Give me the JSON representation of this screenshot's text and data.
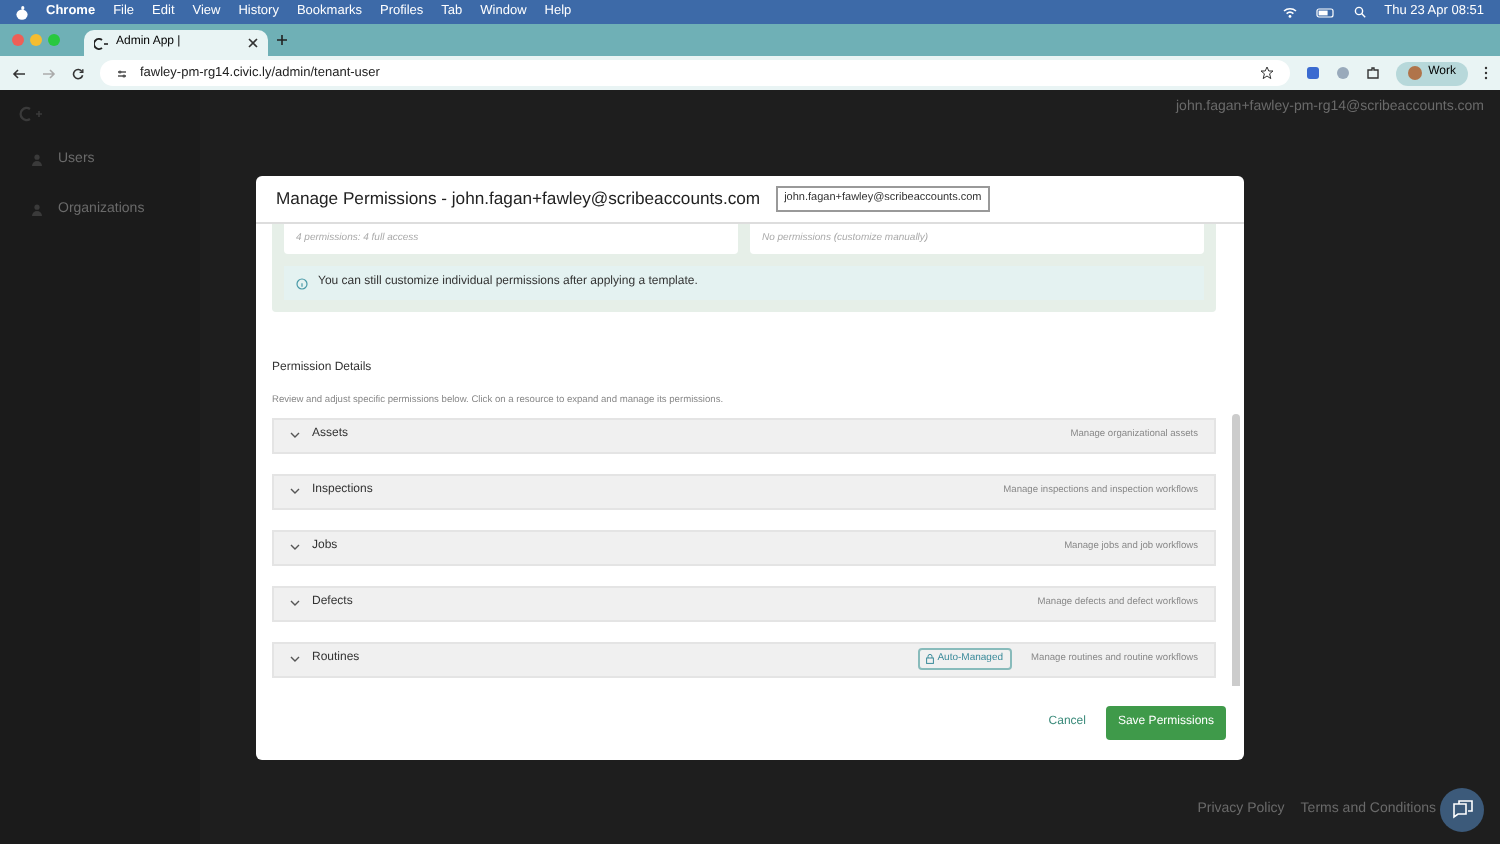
{
  "menubar": {
    "app": "Chrome",
    "menus": [
      "File",
      "Edit",
      "View",
      "History",
      "Bookmarks",
      "Profiles",
      "Tab",
      "Window",
      "Help"
    ],
    "clock": "Thu 23 Apr  08:51"
  },
  "browser": {
    "tabs": [
      {
        "title": "Admin App |",
        "selected": true
      }
    ],
    "url": "fawley-pm-rg14.civic.ly/admin/tenant-user",
    "profile": "Work"
  },
  "app": {
    "sidebar": {
      "items": [
        {
          "label": "Users"
        },
        {
          "label": "Organizations"
        }
      ]
    },
    "header_user": "john.fagan+fawley-pm-rg14@scribeaccounts.com",
    "footer_links": [
      "Privacy Policy",
      "Terms and Conditions"
    ]
  },
  "modal": {
    "title": "Manage Permissions - john.fagan+fawley@scribeaccounts.com",
    "email_badge": "john.fagan+fawley@scribeaccounts.com",
    "templates": [
      {
        "summary": "4 permissions: 4 full access"
      },
      {
        "summary": "No permissions (customize manually)"
      }
    ],
    "info": "You can still customize individual permissions after applying a template.",
    "section_title": "Permission Details",
    "section_help": "Review and adjust specific permissions below. Click on a resource to expand and manage its permissions.",
    "resources": [
      {
        "name": "Assets",
        "description": "Manage organizational assets"
      },
      {
        "name": "Inspections",
        "description": "Manage inspections and inspection workflows"
      },
      {
        "name": "Jobs",
        "description": "Manage jobs and job workflows"
      },
      {
        "name": "Defects",
        "description": "Manage defects and defect workflows"
      },
      {
        "name": "Routines",
        "description": "Manage routines and routine workflows",
        "badge": "Auto-Managed"
      }
    ],
    "cancel": "Cancel",
    "save": "Save Permissions"
  }
}
